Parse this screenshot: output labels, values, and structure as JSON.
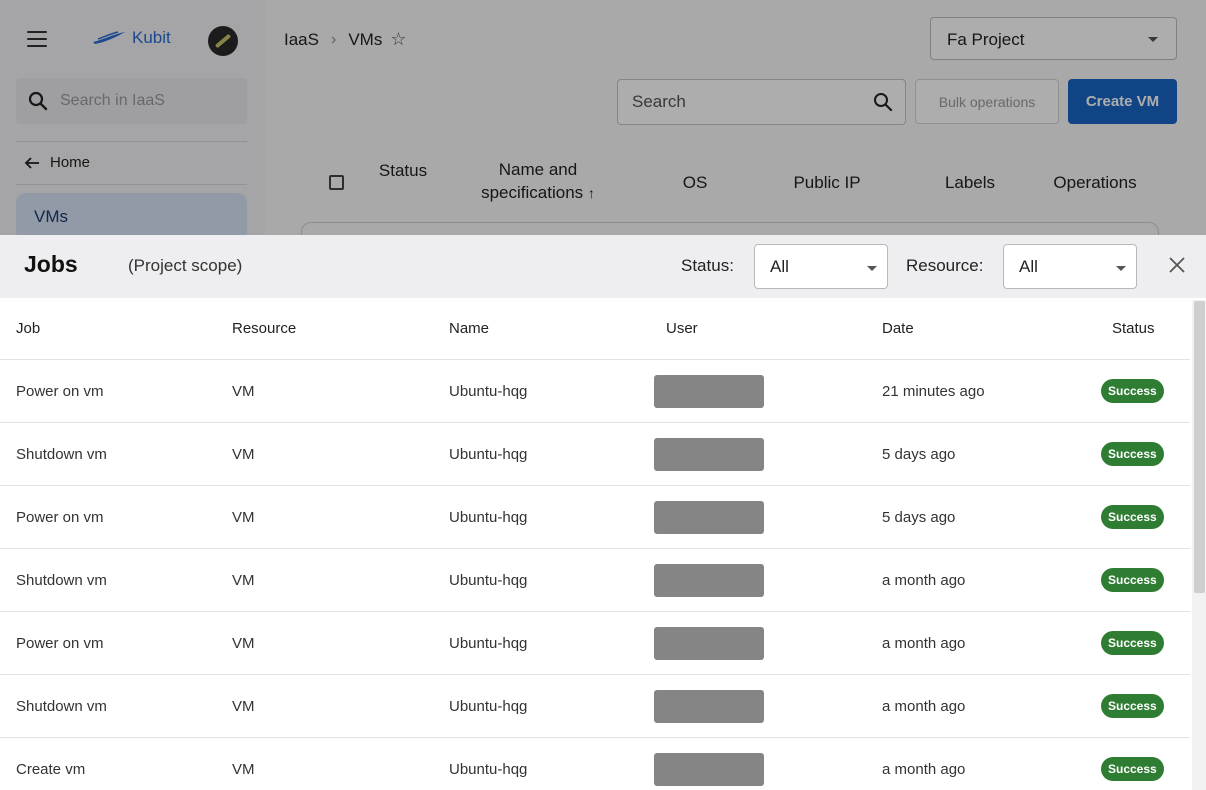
{
  "app": {
    "brand": "Kubit",
    "sidebar": {
      "search_placeholder": "Search in IaaS",
      "home_label": "Home",
      "active_item": "VMs"
    },
    "breadcrumb": [
      "IaaS",
      "VMs"
    ],
    "project_select": "Fa Project",
    "search_placeholder": "Search",
    "bulk_label": "Bulk operations",
    "create_label": "Create VM",
    "vm_table": {
      "columns": [
        "Status",
        "Name and specifications",
        "OS",
        "Public IP",
        "Labels",
        "Operations"
      ],
      "sort_indicator": "↑"
    }
  },
  "jobs": {
    "title": "Jobs",
    "scope": "(Project scope)",
    "status_filter_label": "Status:",
    "status_filter_value": "All",
    "resource_filter_label": "Resource:",
    "resource_filter_value": "All",
    "columns": [
      "Job",
      "Resource",
      "Name",
      "User",
      "Date",
      "Status"
    ],
    "rows": [
      {
        "job": "Power on vm",
        "resource": "VM",
        "name": "Ubuntu-hqg",
        "date": "21 minutes ago",
        "status": "Success"
      },
      {
        "job": "Shutdown vm",
        "resource": "VM",
        "name": "Ubuntu-hqg",
        "date": "5 days ago",
        "status": "Success"
      },
      {
        "job": "Power on vm",
        "resource": "VM",
        "name": "Ubuntu-hqg",
        "date": "5 days ago",
        "status": "Success"
      },
      {
        "job": "Shutdown vm",
        "resource": "VM",
        "name": "Ubuntu-hqg",
        "date": "a month ago",
        "status": "Success"
      },
      {
        "job": "Power on vm",
        "resource": "VM",
        "name": "Ubuntu-hqg",
        "date": "a month ago",
        "status": "Success"
      },
      {
        "job": "Shutdown vm",
        "resource": "VM",
        "name": "Ubuntu-hqg",
        "date": "a month ago",
        "status": "Success"
      },
      {
        "job": "Create vm",
        "resource": "VM",
        "name": "Ubuntu-hqg",
        "date": "a month ago",
        "status": "Success"
      }
    ]
  },
  "colors": {
    "brand": "#2b6cd3",
    "primary_button": "#1865c4",
    "success_badge": "#2e7d32",
    "selected_nav": "#d7e3f8"
  }
}
